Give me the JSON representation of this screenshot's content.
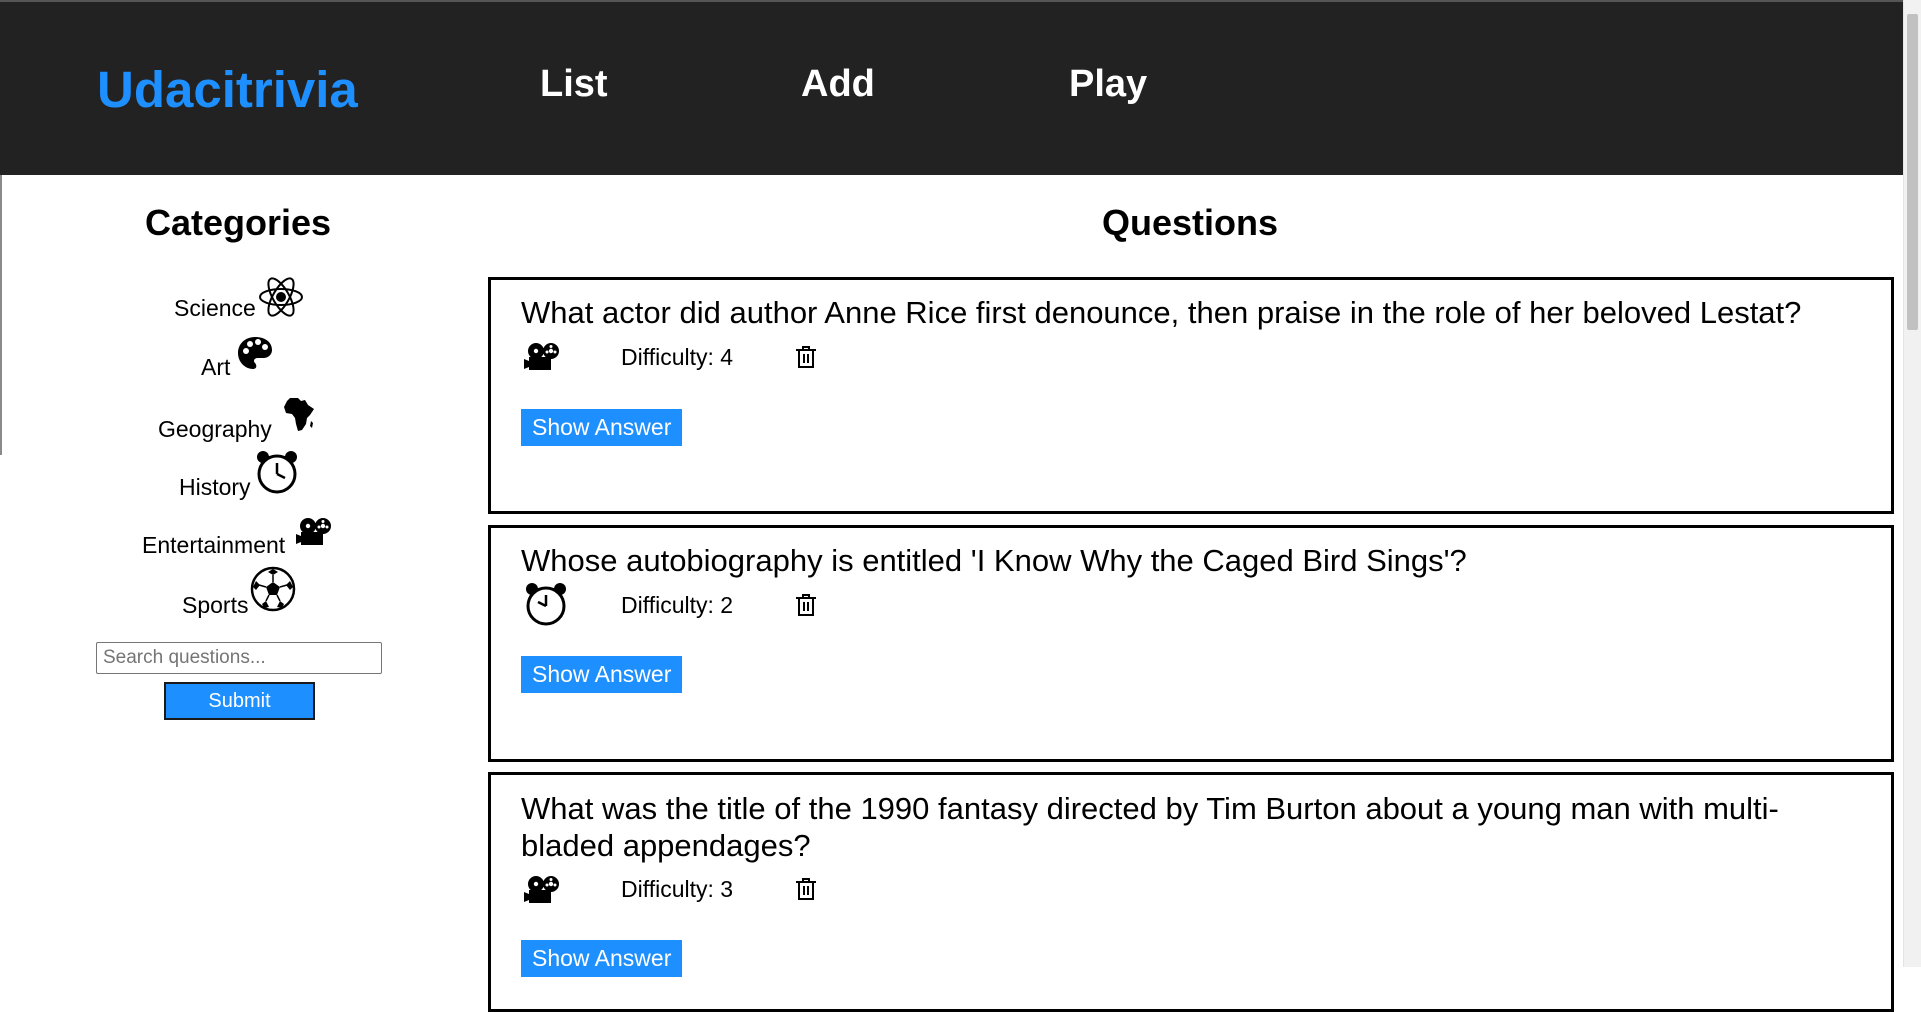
{
  "header": {
    "brand": "Udacitrivia",
    "nav": {
      "list": "List",
      "add": "Add",
      "play": "Play"
    }
  },
  "categories": {
    "title": "Categories",
    "items": [
      {
        "label": "Science",
        "icon": "atom-icon"
      },
      {
        "label": "Art",
        "icon": "palette-icon"
      },
      {
        "label": "Geography",
        "icon": "africa-map-icon"
      },
      {
        "label": "History",
        "icon": "alarm-clock-icon"
      },
      {
        "label": "Entertainment",
        "icon": "film-projector-icon"
      },
      {
        "label": "Sports",
        "icon": "soccer-ball-icon"
      }
    ],
    "search_placeholder": "Search questions...",
    "submit_label": "Submit"
  },
  "questions": {
    "title": "Questions",
    "items": [
      {
        "text": "What actor did author Anne Rice first denounce, then praise in the role of her beloved Lestat?",
        "category_icon": "film-projector-icon",
        "difficulty": "Difficulty: 4",
        "show_answer": "Show Answer"
      },
      {
        "text": "Whose autobiography is entitled 'I Know Why the Caged Bird Sings'?",
        "category_icon": "alarm-clock-icon",
        "difficulty": "Difficulty: 2",
        "show_answer": "Show Answer"
      },
      {
        "text": "What was the title of the 1990 fantasy directed by Tim Burton about a young man with multi-bladed appendages?",
        "category_icon": "film-projector-icon",
        "difficulty": "Difficulty: 3",
        "show_answer": "Show Answer"
      }
    ]
  },
  "colors": {
    "header_bg": "#222222",
    "brand": "#1e8fff",
    "button": "#1e8fff"
  }
}
